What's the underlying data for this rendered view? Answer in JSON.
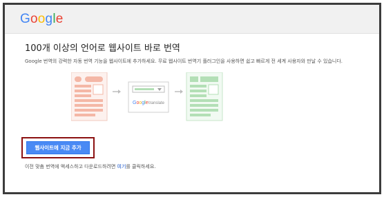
{
  "header": {
    "logo_letters": [
      {
        "ch": "G",
        "color": "#4285F4"
      },
      {
        "ch": "o",
        "color": "#EA4335"
      },
      {
        "ch": "o",
        "color": "#FBBC05"
      },
      {
        "ch": "g",
        "color": "#4285F4"
      },
      {
        "ch": "l",
        "color": "#34A853"
      },
      {
        "ch": "e",
        "color": "#EA4335"
      }
    ]
  },
  "main": {
    "title": "100개 이상의 언어로 웹사이트 바로 번역",
    "description": "Google 번역의 강력한 자동 번역 기능을 웹사이트에 추가하세요. 무료 웹사이트 번역기 플러그인을 사용하면 쉽고 빠르게 전 세계 사용자와 만날 수 있습니다.",
    "cta_label": "웹사이트에 지금 추가",
    "footer_before": "이전 맞춤 번역에 액세스하고 다운로드하려면 ",
    "footer_link": "여기",
    "footer_after": "를 클릭하세요."
  },
  "widget": {
    "brand": "Google",
    "word": "translate"
  },
  "colors": {
    "source_page": "#f4b7a6",
    "target_page": "#b3dfb6",
    "cta_bg": "#4a8af4",
    "cta_outline": "#8b1010",
    "link": "#1a55c9"
  }
}
